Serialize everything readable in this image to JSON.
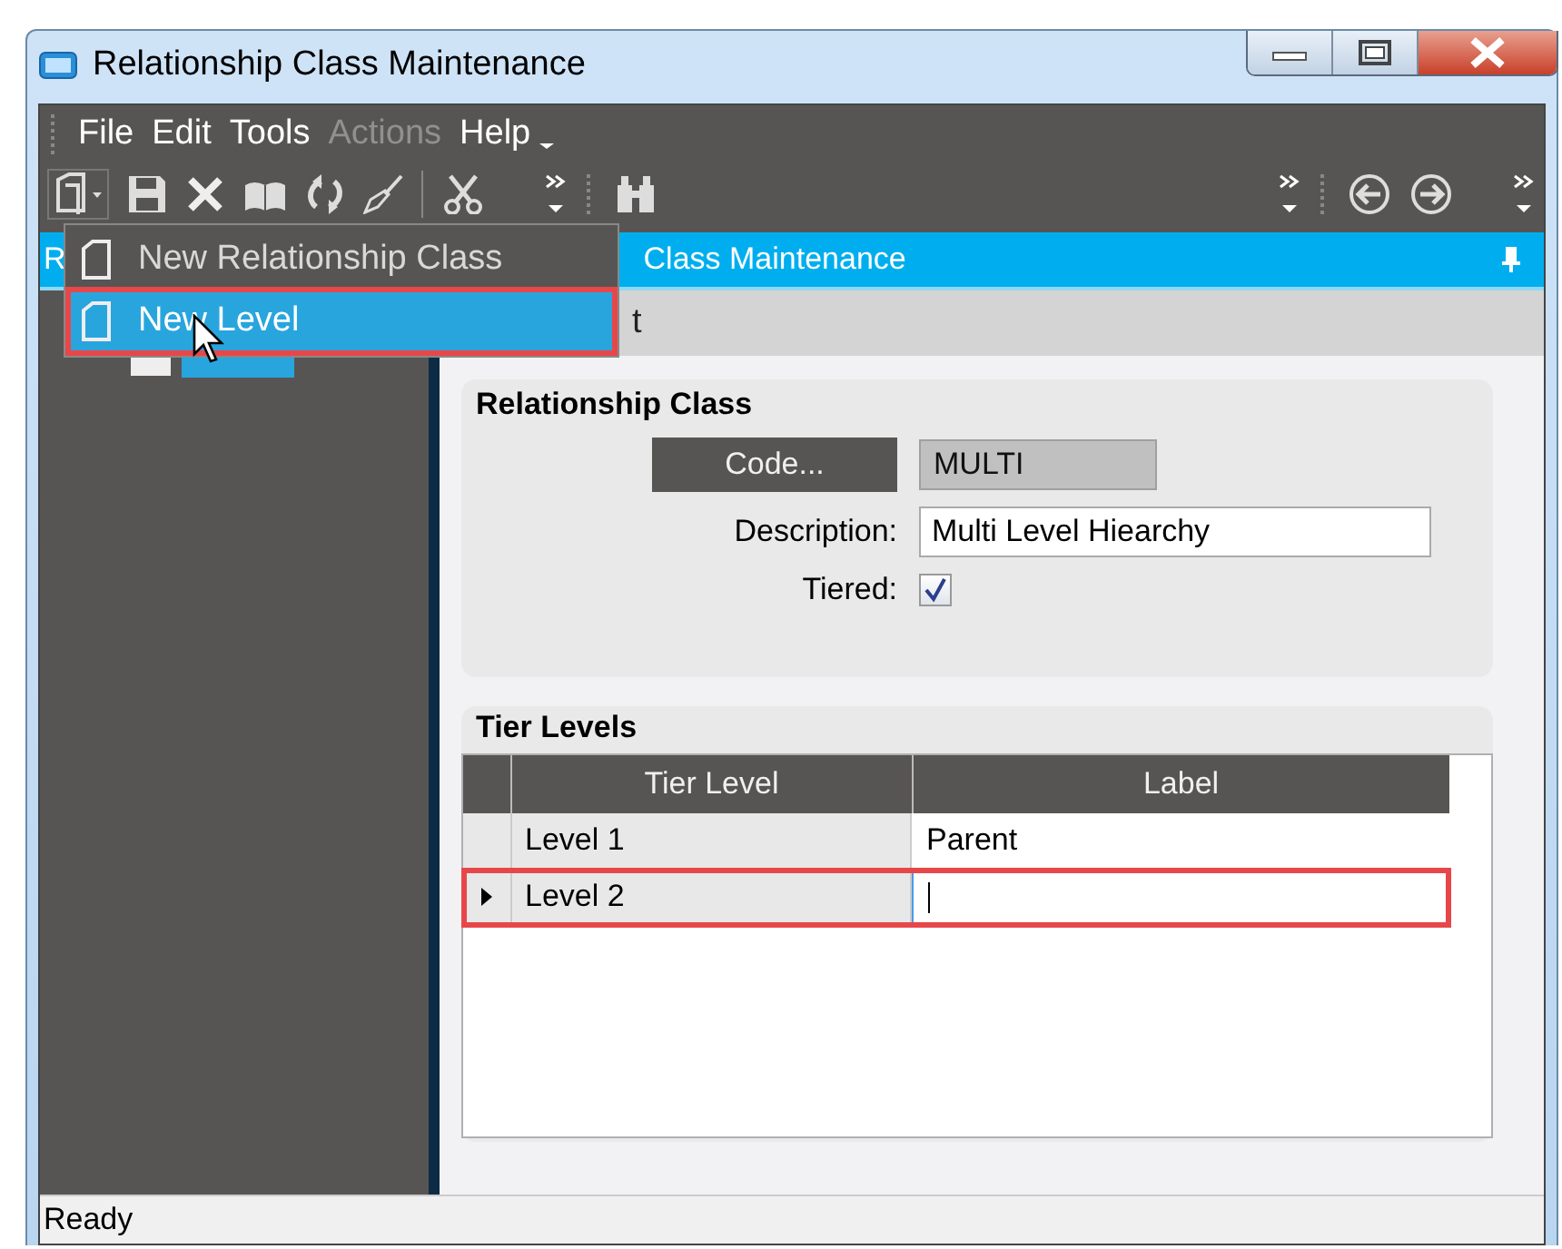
{
  "window": {
    "title": "Relationship Class Maintenance"
  },
  "menu": [
    {
      "label": "File",
      "disabled": false
    },
    {
      "label": "Edit",
      "disabled": false
    },
    {
      "label": "Tools",
      "disabled": false
    },
    {
      "label": "Actions",
      "disabled": true
    },
    {
      "label": "Help",
      "disabled": false
    }
  ],
  "panel": {
    "title_parts": [
      "R",
      "Class Maintenance"
    ]
  },
  "dropdown": {
    "items": [
      {
        "label": "New Relationship Class",
        "selected": false,
        "annotated": false
      },
      {
        "label": "New Level",
        "selected": true,
        "annotated": true
      }
    ]
  },
  "tab_strip": {
    "label_fragment": "t"
  },
  "relationship_class": {
    "title": "Relationship Class",
    "code_button": "Code...",
    "code_value": "MULTI",
    "description_label": "Description:",
    "description_value": "Multi Level Hiearchy",
    "tiered_label": "Tiered:",
    "tiered_checked": true
  },
  "tier_levels": {
    "title": "Tier Levels",
    "columns": [
      "Tier Level",
      "Label"
    ],
    "rows": [
      {
        "tier_level": "Level 1",
        "label": "Parent",
        "selected": false,
        "annotated": false
      },
      {
        "tier_level": "Level 2",
        "selected": true,
        "annotated": true
      }
    ]
  },
  "status_bar": "Ready"
}
